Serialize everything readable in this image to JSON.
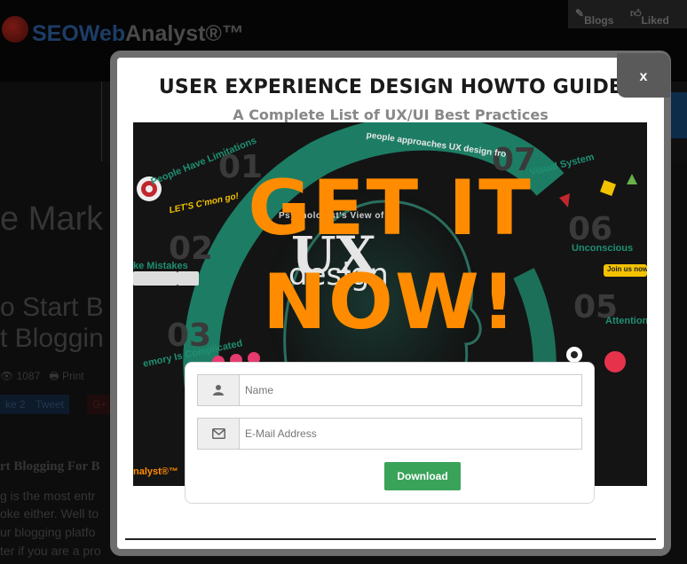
{
  "background_page": {
    "logo": {
      "part1": "SEO",
      "part2": "Web",
      "part3": "Analyst®™"
    },
    "top_links": {
      "blogs": "Blogs",
      "liked": "Liked"
    },
    "heading_fragment": "e Mark",
    "post_title_line1": "o Start B",
    "post_title_line2": "t Bloggin",
    "views": "1087",
    "print": "Print",
    "share_like": "ke 2",
    "share_tweet": "Tweet",
    "share_gplus": "G+",
    "article_subheading": "rt Blogging For B",
    "article_lines": [
      "g is the most entr",
      "oke either. Well to",
      "ur blogging platfo",
      "ter if you are a pro"
    ]
  },
  "modal": {
    "close_label": "x",
    "title": "USER EXPERIENCE DESIGN HOWTO GUIDE",
    "subtitle": "A Complete List of UX/UI Best Practices",
    "infographic": {
      "cta_line1": "GET IT",
      "cta_line2": "NOW!",
      "ux": "UX",
      "design": "design",
      "top_label": "Psychologist's View of",
      "people_limitations": "People Have Limitations",
      "approaches": "people approaches UX design fro",
      "visual_system": "Visual System",
      "make_mistakes": "ke Mistakes",
      "unconscious": "Unconscious",
      "attention": "Attention",
      "memory": "emory Is Complicated",
      "lets_go": "LET'S C'mon go!",
      "join_now": "Join us now!",
      "brand": "nalyst®™",
      "numbers": [
        "01",
        "07",
        "02",
        "06",
        "03",
        "05"
      ]
    },
    "form": {
      "name_placeholder": "Name",
      "email_placeholder": "E-Mail Address",
      "download_label": "Download"
    }
  },
  "colors": {
    "cta_orange": "#ff8c00",
    "ring_teal": "#1f8f72",
    "download_green": "#3aa35a",
    "modal_border": "#6e6e6e"
  },
  "icons": {
    "name_field": "user-icon",
    "email_field": "envelope-icon",
    "blogs": "edit-icon",
    "liked": "thumbs-up-icon"
  }
}
